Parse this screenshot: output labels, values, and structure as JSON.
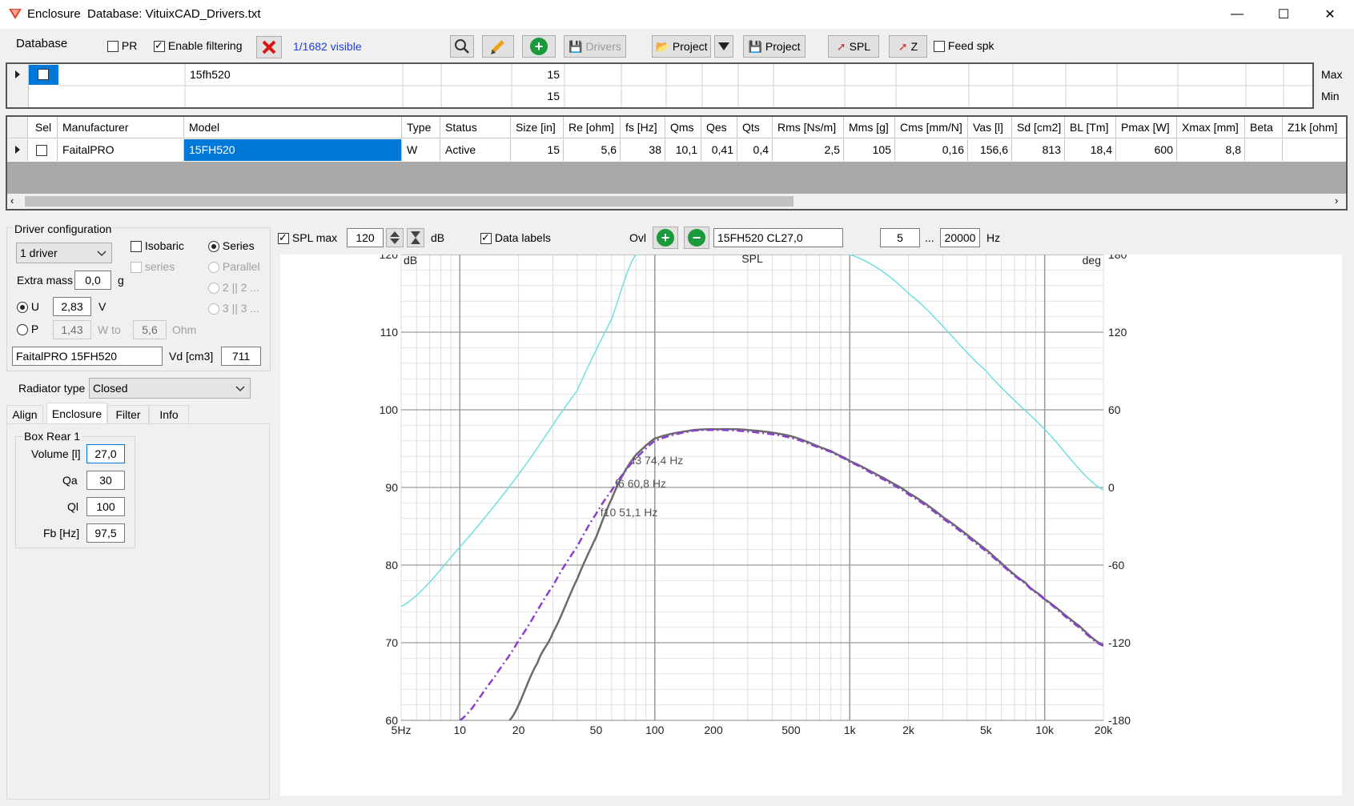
{
  "window": {
    "app": "Enclosure",
    "title": "Database: VituixCAD_Drivers.txt",
    "min": "—",
    "max": "☐",
    "close": "✕"
  },
  "toolbar": {
    "database_label": "Database",
    "pr_label": "PR",
    "pr_checked": false,
    "enable_filtering_label": "Enable filtering",
    "enable_filtering_checked": true,
    "visible_count": "1/1682 visible",
    "drivers_label": "Drivers",
    "project_open_label": "Project",
    "project_save_label": "Project",
    "spl_label": "SPL",
    "z_label": "Z",
    "feed_spk_label": "Feed spk",
    "feed_spk_checked": false
  },
  "filter_grid": {
    "model": "15fh520",
    "size_max": "15",
    "size_min": "15",
    "max_label": "Max",
    "min_label": "Min"
  },
  "driver_grid": {
    "columns": [
      "Sel",
      "Manufacturer",
      "Model",
      "Type",
      "Status",
      "Size [in]",
      "Re [ohm]",
      "fs [Hz]",
      "Qms",
      "Qes",
      "Qts",
      "Rms [Ns/m]",
      "Mms [g]",
      "Cms [mm/N]",
      "Vas [l]",
      "Sd [cm2]",
      "BL [Tm]",
      "Pmax [W]",
      "Xmax [mm]",
      "Beta",
      "Z1k [ohm]"
    ],
    "row": [
      "",
      "FaitalPRO",
      "15FH520",
      "W",
      "Active",
      "15",
      "5,6",
      "38",
      "10,1",
      "0,41",
      "0,4",
      "2,5",
      "105",
      "0,16",
      "156,6",
      "813",
      "18,4",
      "600",
      "8,8",
      "",
      ""
    ]
  },
  "driver_config": {
    "group_label": "Driver configuration",
    "driver_count": "1 driver",
    "isobaric_label": "Isobaric",
    "series_chk_label": "series",
    "series_label": "Series",
    "parallel_label": "Parallel",
    "opt_2": "2 || 2 ...",
    "opt_3": "3 || 3 ...",
    "extra_mass_label": "Extra mass",
    "extra_mass": "0,0",
    "extra_mass_unit": "g",
    "u_label": "U",
    "u_value": "2,83",
    "u_unit": "V",
    "p_label": "P",
    "p_value": "1,43",
    "w_to": "W to",
    "ohm_value": "5,6",
    "ohm_unit": "Ohm",
    "driver_name": "FaitalPRO 15FH520",
    "vd_label": "Vd [cm3]",
    "vd_value": "711"
  },
  "radiator": {
    "label": "Radiator type",
    "value": "Closed"
  },
  "tabs": [
    "Align",
    "Enclosure",
    "Filter",
    "Info"
  ],
  "box": {
    "group_label": "Box Rear 1",
    "volume_label": "Volume [l]",
    "volume": "27,0",
    "qa_label": "Qa",
    "qa": "30",
    "ql_label": "Ql",
    "ql": "100",
    "fb_label": "Fb [Hz]",
    "fb": "97,5"
  },
  "chart_toolbar": {
    "spl_max_label": "SPL max",
    "spl_max_checked": true,
    "spl_max": "120",
    "db_unit": "dB",
    "data_labels_label": "Data labels",
    "data_labels_checked": true,
    "ovl_label": "Ovl",
    "overlay_name": "15FH520 CL27,0",
    "f_min": "5",
    "range_sep": "...",
    "f_max": "20000",
    "hz_unit": "Hz"
  },
  "chart_data": {
    "type": "line",
    "title": "SPL",
    "ylabel": "dB",
    "y2label": "deg",
    "xscale": "log",
    "xlim": [
      5,
      20000
    ],
    "ylim": [
      60,
      120
    ],
    "y2lim": [
      -180,
      180
    ],
    "x_ticks": [
      5,
      10,
      20,
      50,
      100,
      200,
      500,
      1000,
      2000,
      5000,
      10000,
      20000
    ],
    "x_tick_labels": [
      "5Hz",
      "10",
      "20",
      "50",
      "100",
      "200",
      "500",
      "1k",
      "2k",
      "5k",
      "10k",
      "20k"
    ],
    "y_ticks": [
      60,
      70,
      80,
      90,
      100,
      110,
      120
    ],
    "y2_ticks": [
      -180,
      -120,
      -60,
      0,
      60,
      120,
      180
    ],
    "grid": true,
    "colors": {
      "spl": "#6b6b6b",
      "overlay": "#8a3fd1",
      "phase": "#6fe0e0"
    },
    "series": [
      {
        "key": "spl",
        "axis": "left",
        "x": [
          18,
          25,
          30,
          40,
          50,
          60,
          70,
          80,
          100,
          150,
          200,
          300,
          500,
          800,
          1000,
          1500,
          2000,
          3000,
          5000,
          8000,
          10000,
          15000,
          20000
        ],
        "y": [
          60,
          67.4,
          71.3,
          78.2,
          83.6,
          88.5,
          92,
          94.2,
          96.3,
          97.3,
          97.5,
          97.4,
          96.6,
          94.7,
          93.4,
          91.2,
          89.3,
          86.2,
          82.0,
          77.7,
          75.6,
          72.2,
          69.7
        ]
      },
      {
        "key": "overlay",
        "axis": "left",
        "style": "dashdot",
        "x": [
          10,
          15,
          20,
          30,
          40,
          50,
          60,
          70,
          80,
          100,
          150,
          200,
          300,
          500,
          800,
          1000,
          1500,
          2000,
          3000,
          5000,
          8000,
          10000,
          15000,
          20000
        ],
        "y": [
          60,
          65.5,
          70.3,
          77.3,
          82.4,
          86.6,
          89.6,
          92,
          93.8,
          96,
          97.2,
          97.4,
          97.2,
          96.4,
          94.6,
          93.3,
          91.0,
          89.1,
          86.0,
          81.8,
          77.6,
          75.5,
          72.0,
          69.6
        ]
      },
      {
        "key": "phase",
        "axis": "right",
        "x": [
          5,
          10,
          20,
          40,
          60,
          80,
          1000,
          2000,
          5000,
          10000,
          20000
        ],
        "y": [
          -92,
          -46,
          10,
          75,
          130,
          180,
          180,
          150,
          90,
          45,
          -2
        ]
      }
    ],
    "annotations": [
      {
        "text": "f3 74,4 Hz",
        "x": 74.4,
        "y": 93.5
      },
      {
        "text": "f6 60,8 Hz",
        "x": 60.8,
        "y": 90.5
      },
      {
        "text": "f10 51,1 Hz",
        "x": 51.1,
        "y": 86.8
      }
    ]
  }
}
